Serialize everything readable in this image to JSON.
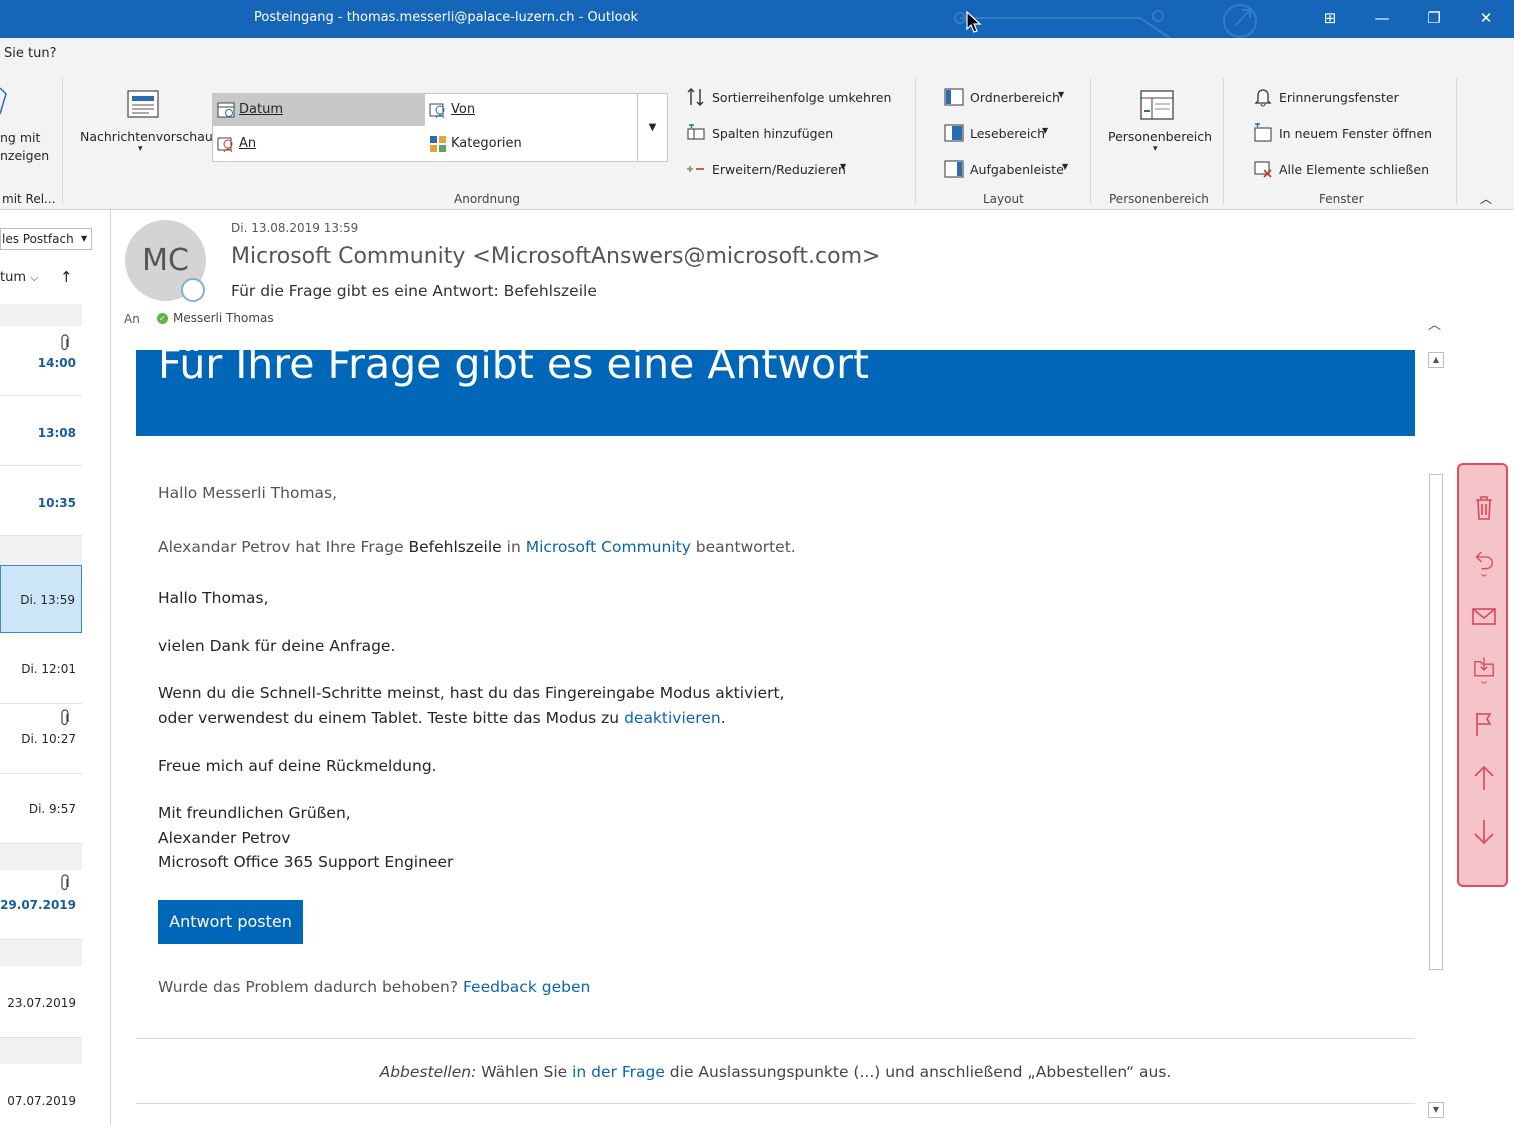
{
  "window": {
    "title": "Posteingang - thomas.messerli@palace-luzern.ch  -  Outlook",
    "controls": {
      "ribbon_display": "⊞",
      "minimize": "—",
      "restore": "❐",
      "close": "✕"
    }
  },
  "ribbon": {
    "tell_me": "Sie tun?",
    "left_group": {
      "line1": "ng mit",
      "line2": "nzeigen",
      "bottom": "mit Rel..."
    },
    "message_preview": "Nachrichtenvorschau",
    "arrangement": {
      "items": [
        "Datum",
        "Von",
        "An",
        "Kategorien"
      ],
      "selected": "Datum",
      "group_label": "Anordnung"
    },
    "sort_actions": [
      "Sortierreihenfolge umkehren",
      "Spalten hinzufügen",
      "Erweitern/Reduzieren"
    ],
    "layout": {
      "items": [
        "Ordnerbereich",
        "Lesebereich",
        "Aufgabenleiste"
      ],
      "group_label": "Layout"
    },
    "people": {
      "button": "Personenbereich",
      "group_label": "Personenbereich"
    },
    "window_group": {
      "items": [
        "Erinnerungsfenster",
        "In neuem Fenster öffnen",
        "Alle Elemente schließen"
      ],
      "group_label": "Fenster"
    }
  },
  "list": {
    "scope": "les Postfach",
    "sort_by": "tum",
    "rows": [
      {
        "time": "14:00",
        "attachment": true,
        "unread": true
      },
      {
        "time": "13:08",
        "attachment": false,
        "unread": true
      },
      {
        "time": "10:35",
        "attachment": false,
        "unread": true
      },
      {
        "time": "Di. 13:59",
        "attachment": false,
        "unread": false,
        "selected": true
      },
      {
        "time": "Di. 12:01",
        "attachment": false,
        "unread": false
      },
      {
        "time": "Di. 10:27",
        "attachment": true,
        "unread": false
      },
      {
        "time": "Di. 9:57",
        "attachment": false,
        "unread": false
      },
      {
        "time": "29.07.2019",
        "attachment": true,
        "unread": true
      },
      {
        "time": "23.07.2019",
        "attachment": false,
        "unread": false
      },
      {
        "time": "07.07.2019",
        "attachment": false,
        "unread": false
      }
    ]
  },
  "message": {
    "date": "Di. 13.08.2019 13:59",
    "avatar_initials": "MC",
    "from": "Microsoft Community <MicrosoftAnswers@microsoft.com>",
    "subject": "Für die Frage gibt es eine Antwort: Befehlszeile",
    "to_label": "An",
    "to": "Messerli Thomas",
    "body": {
      "banner": "Für Ihre Frage gibt es eine Antwort",
      "greeting1": "Hallo Messerli Thomas,",
      "intro_a": "Alexandar Petrov hat Ihre Frage ",
      "intro_topic": "Befehlszeile",
      "intro_in": " in ",
      "intro_link": "Microsoft Community",
      "intro_b": " beantwortet.",
      "greeting2": "Hallo Thomas,",
      "thanks": "vielen Dank für deine Anfrage.",
      "p1_line1": "Wenn du die Schnell-Schritte meinst, hast du das Fingereingabe Modus aktiviert,",
      "p1_line2a": "oder verwendest du einem Tablet. Teste bitte das Modus zu ",
      "p1_link": "deaktivieren",
      "p1_line2b": ".",
      "closing": "Freue mich auf deine Rückmeldung.",
      "sig1": "Mit freundlichen Grüßen,",
      "sig2": "Alexander Petrov",
      "sig3": "Microsoft Office 365 Support Engineer",
      "post_button": "Antwort posten",
      "feedback_q": "Wurde das Problem dadurch behoben? ",
      "feedback_link": "Feedback geben",
      "unsub_label": "Abbestellen:",
      "unsub_a": " Wählen Sie ",
      "unsub_link": "in der Frage",
      "unsub_b": " die Auslassungspunkte (...) und anschließend „Abbestellen“ aus."
    }
  },
  "colors": {
    "accent": "#0067b8",
    "titlebar": "#1566b8",
    "sidebar_bg": "#f4c4c9",
    "sidebar_border": "#e64b5c"
  }
}
